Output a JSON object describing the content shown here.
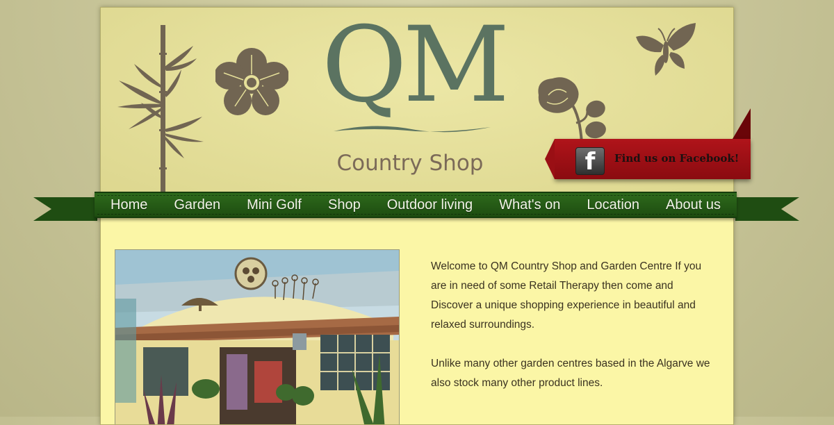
{
  "header": {
    "logo_main": "QM",
    "logo_sub": "Country Shop"
  },
  "facebook": {
    "icon_letter": "f",
    "label": "Find us on Facebook!"
  },
  "nav": {
    "items": [
      "Home",
      "Garden",
      "Mini Golf",
      "Shop",
      "Outdoor living",
      "What's on",
      "Location",
      "About us"
    ]
  },
  "content": {
    "paragraphs": [
      "Welcome to QM Country Shop and Garden Centre If you are in need of some Retail Therapy then come and Discover a unique shopping experience in beautiful and relaxed surroundings.",
      "Unlike many other garden centres based in the Algarve we also stock many other product lines."
    ]
  },
  "colors": {
    "page_bg": "#ede79a",
    "content_bg": "#fbf6a6",
    "logo_green": "#5b7361",
    "nav_green": "#2e6a1c",
    "fb_red": "#9a0f14",
    "decoration_brown": "#716552"
  }
}
